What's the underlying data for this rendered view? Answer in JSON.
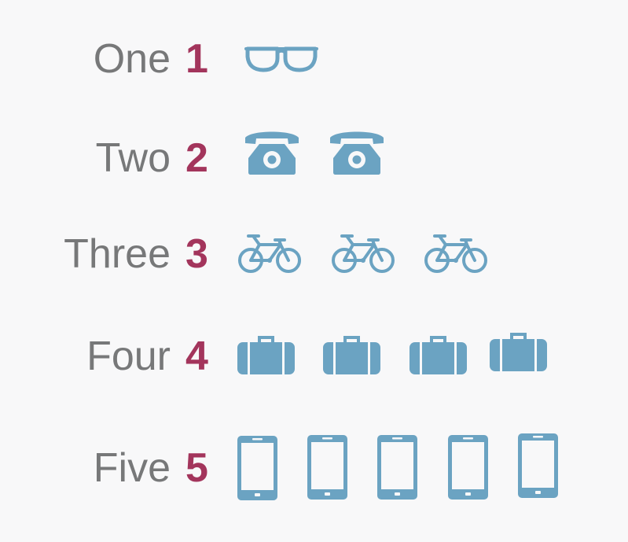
{
  "colors": {
    "background": "#f8f8f9",
    "word": "#777879",
    "number": "#a3355c",
    "icon": "#6ba3c2"
  },
  "rows": [
    {
      "word": "One",
      "number": "1",
      "icon": "glasses-icon",
      "count": 1
    },
    {
      "word": "Two",
      "number": "2",
      "icon": "telephone-icon",
      "count": 2
    },
    {
      "word": "Three",
      "number": "3",
      "icon": "bicycle-icon",
      "count": 3
    },
    {
      "word": "Four",
      "number": "4",
      "icon": "suitcase-icon",
      "count": 4
    },
    {
      "word": "Five",
      "number": "5",
      "icon": "smartphone-icon",
      "count": 5
    }
  ]
}
